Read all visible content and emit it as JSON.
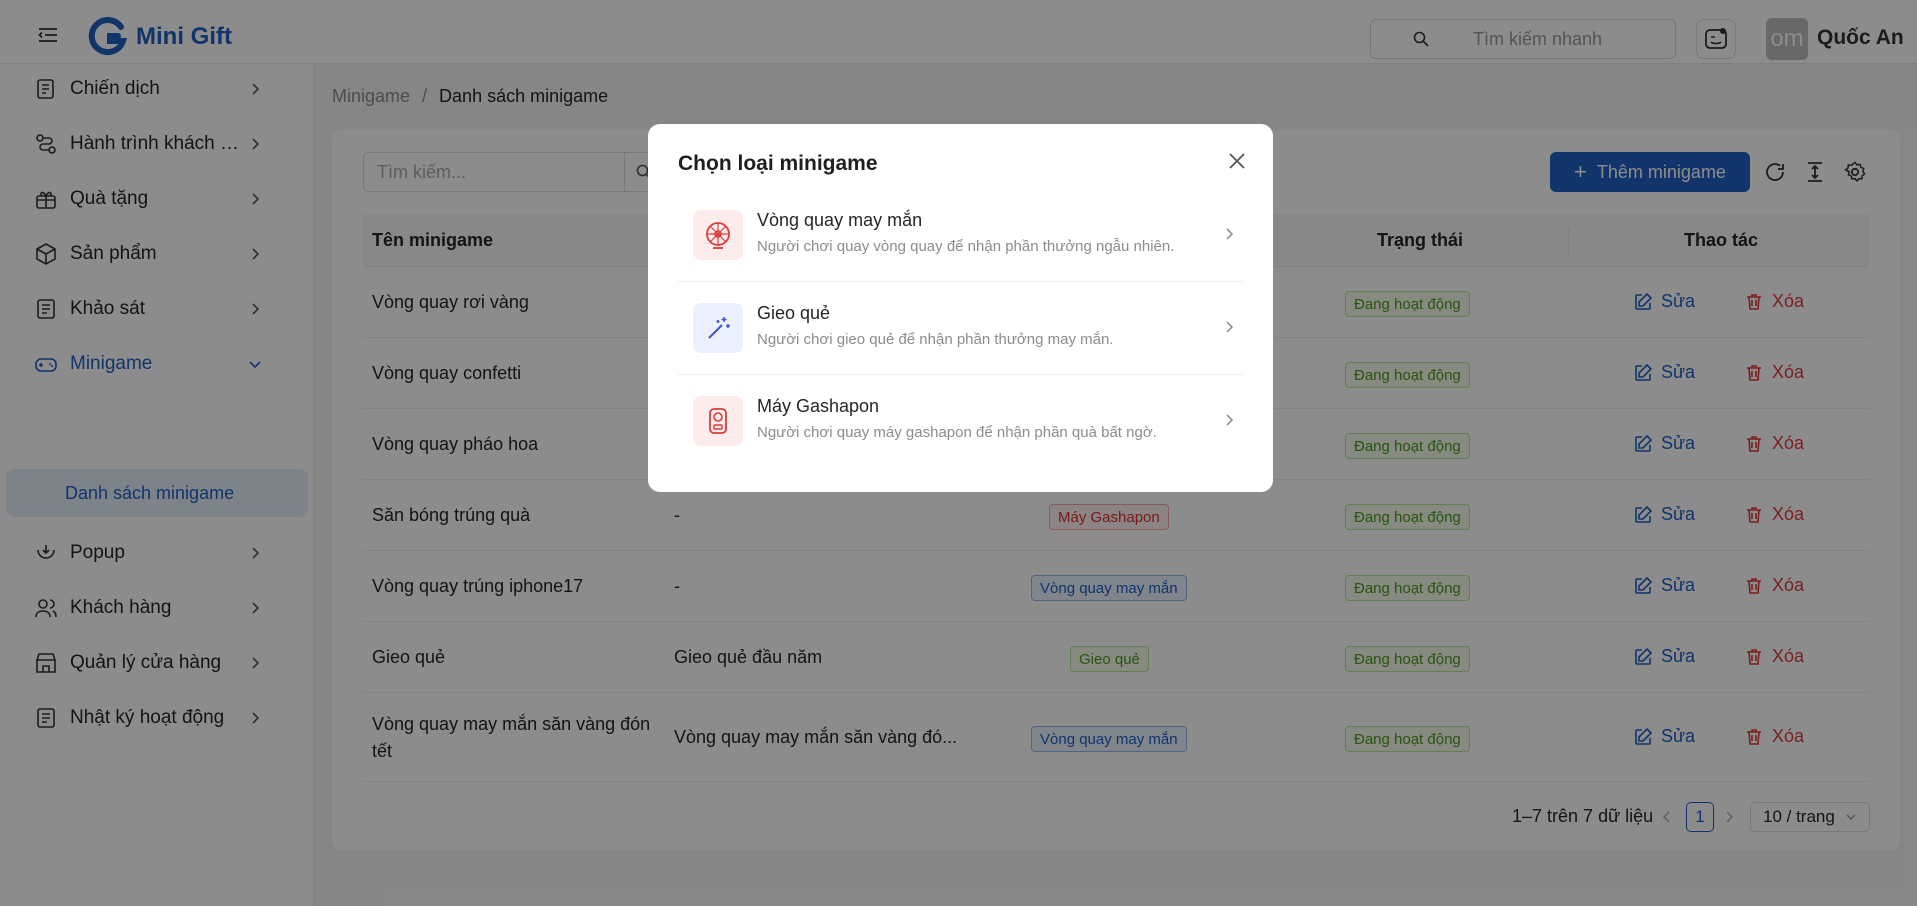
{
  "header": {
    "logo_text": "Mini Gift",
    "search_placeholder": "Tìm kiếm nhanh",
    "avatar_text": "om",
    "user_name": "Quốc An"
  },
  "sidebar": {
    "items": [
      {
        "label": "Chiến dịch"
      },
      {
        "label": "Hành trình khách hàng"
      },
      {
        "label": "Quà tặng"
      },
      {
        "label": "Sản phẩm"
      },
      {
        "label": "Khảo sát"
      },
      {
        "label": "Minigame"
      },
      {
        "label": "Popup"
      },
      {
        "label": "Khách hàng"
      },
      {
        "label": "Quản lý cửa hàng"
      },
      {
        "label": "Nhật ký hoạt động"
      }
    ],
    "sub_item": "Danh sách minigame"
  },
  "breadcrumb": {
    "parent": "Minigame",
    "separator": "/",
    "current": "Danh sách minigame"
  },
  "toolbar": {
    "search_placeholder": "Tìm kiếm...",
    "add_label": "Thêm minigame"
  },
  "table": {
    "headers": {
      "name": "Tên minigame",
      "status": "Trạng thái",
      "actions": "Thao tác"
    },
    "edit_label": "Sửa",
    "delete_label": "Xóa",
    "rows": [
      {
        "name": "Vòng quay rơi vàng",
        "desc": "",
        "type": "",
        "status": "Đang hoạt động"
      },
      {
        "name": "Vòng quay confetti",
        "desc": "",
        "type": "",
        "status": "Đang hoạt động"
      },
      {
        "name": "Vòng quay pháo hoa",
        "desc": "",
        "type": "",
        "status": "Đang hoạt động"
      },
      {
        "name": "Săn bóng trúng quà",
        "desc": "-",
        "type": "Máy Gashapon",
        "status": "Đang hoạt động"
      },
      {
        "name": "Vòng quay trúng iphone17",
        "desc": "-",
        "type": "Vòng quay may mắn",
        "status": "Đang hoạt động"
      },
      {
        "name": "Gieo quẻ",
        "desc": "Gieo quẻ đầu năm",
        "type": "Gieo quẻ",
        "status": "Đang hoạt động"
      },
      {
        "name_line1": "Vòng quay may mắn săn vàng đón",
        "name_line2": "tết",
        "desc": "Vòng quay may mắn săn vàng đó...",
        "type": "Vòng quay may mắn",
        "status": "Đang hoạt động"
      }
    ]
  },
  "pagination": {
    "summary": "1–7 trên 7 dữ liệu",
    "current_page": "1",
    "page_size": "10 / trang"
  },
  "modal": {
    "title": "Chọn loại minigame",
    "options": [
      {
        "title": "Vòng quay may mắn",
        "desc": "Người chơi quay vòng quay để nhận phần thưởng ngẫu nhiên.",
        "icon": "wheel-icon"
      },
      {
        "title": "Gieo quẻ",
        "desc": "Người chơi gieo quẻ để nhận phần thưởng may mắn.",
        "icon": "magic-wand-icon"
      },
      {
        "title": "Máy Gashapon",
        "desc": "Người chơi quay máy gashapon để nhận phần quà bất ngờ.",
        "icon": "gashapon-icon"
      }
    ]
  },
  "colors": {
    "primary": "#1f5fc4",
    "danger": "#e03a3a",
    "success": "#4b9c1e"
  }
}
